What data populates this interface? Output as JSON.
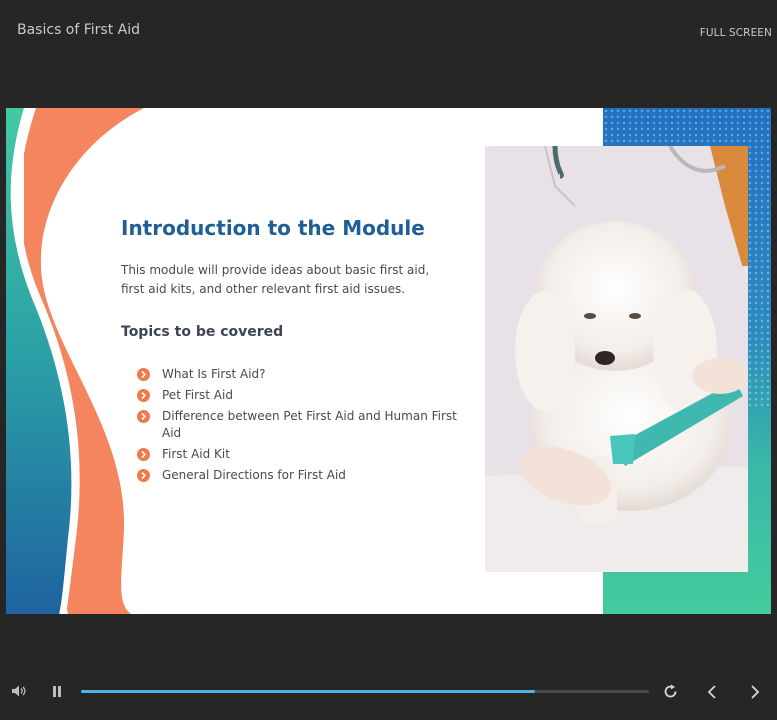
{
  "header": {
    "course_title": "Basics of First Aid",
    "fullscreen_label": "FULL SCREEN"
  },
  "slide": {
    "heading": "Introduction to the Module",
    "intro": "This module will provide ideas about basic first aid, first aid kits, and other relevant first aid issues.",
    "topics_heading": "Topics to be covered",
    "topics": [
      "What Is First Aid?",
      "Pet First Aid",
      "Difference between Pet First Aid and Human First Aid",
      "First Aid Kit",
      "General Directions for First Aid"
    ],
    "photo_subject": "veterinarian bandaging a white dog's paw"
  },
  "controls": {
    "volume_icon": "speaker-icon",
    "pause_icon": "pause-icon",
    "replay_icon": "replay-icon",
    "prev_icon": "chevron-left-icon",
    "next_icon": "chevron-right-icon",
    "progress_fraction": 0.8
  },
  "colors": {
    "accent_blue": "#1f5f96",
    "accent_orange": "#ef7a4b",
    "accent_teal": "#3ec9a0",
    "progress_fill": "#54b1e6"
  }
}
